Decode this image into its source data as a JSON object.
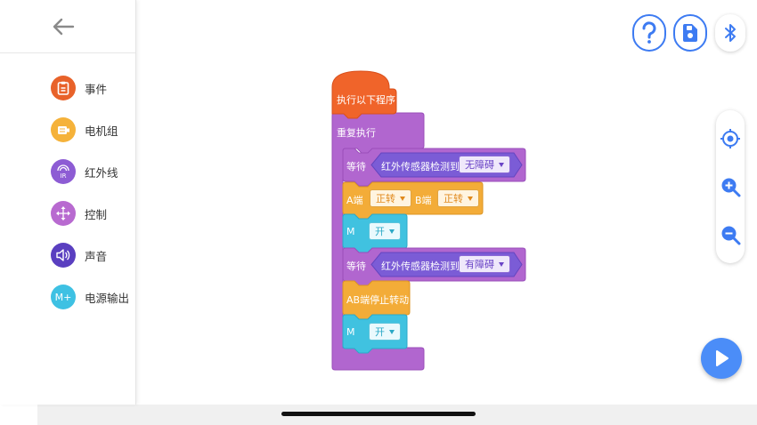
{
  "sidebar": {
    "categories": [
      {
        "label": "事件",
        "icon": "clipboard-icon",
        "color": "#e8622a"
      },
      {
        "label": "电机组",
        "icon": "motor-icon",
        "color": "#f5b23a"
      },
      {
        "label": "红外线",
        "icon": "infrared-icon",
        "color": "#8d5cd4"
      },
      {
        "label": "控制",
        "icon": "control-arrows-icon",
        "color": "#b86ad0"
      },
      {
        "label": "声音",
        "icon": "speaker-icon",
        "color": "#5a3fc0"
      },
      {
        "label": "电源输出",
        "icon": "power-output-icon",
        "color": "#3ec1e3",
        "icon_text": "M+"
      }
    ]
  },
  "program": {
    "hat": "执行以下程序",
    "loop": "重复执行",
    "wait1": {
      "label": "等待",
      "sensor": "红外传感器检测到",
      "value": "无障碍"
    },
    "motor": {
      "a_label": "A端",
      "a_value": "正转",
      "b_label": "B端",
      "b_value": "正转"
    },
    "m1": {
      "label": "M",
      "value": "开"
    },
    "wait2": {
      "label": "等待",
      "sensor": "红外传感器检测到",
      "value": "有障碍"
    },
    "stop": "AB端停止转动",
    "m2": {
      "label": "M",
      "value": "开"
    }
  },
  "colors": {
    "hat": "#f0642a",
    "control": "#b166cf",
    "infrared": "#7b5cd6",
    "motor": "#f3ac38",
    "power": "#40c2e0",
    "accent": "#3d7bf2"
  }
}
